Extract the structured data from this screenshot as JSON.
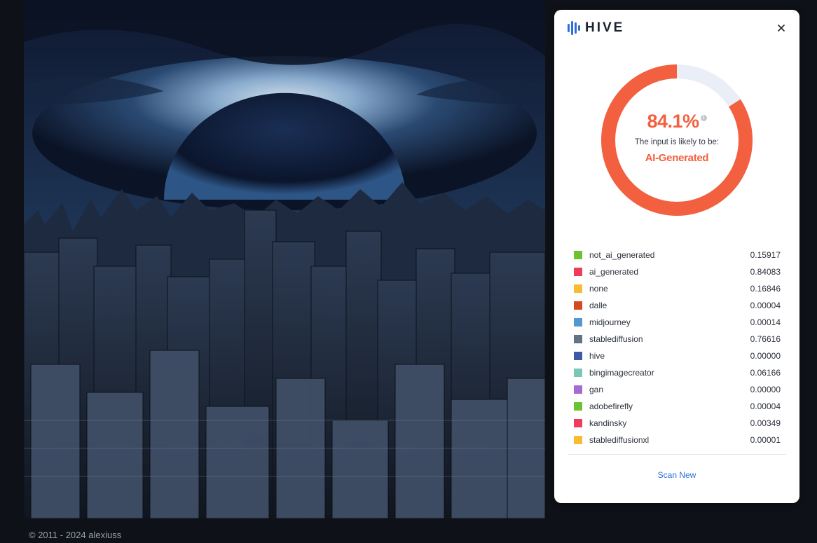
{
  "artwork": {
    "subject": "dark ruined city skyline under a black sphere eclipse with glowing blue clouds"
  },
  "footer": {
    "copyright": "© 2011 - 2024 alexiuss"
  },
  "panel": {
    "brand": "HIVE",
    "close_icon": "close-icon",
    "score": "84.1%",
    "score_fraction": 0.841,
    "likely_text": "The input is likely to be:",
    "verdict": "AI-Generated",
    "accent_color": "#f2603f",
    "track_color": "#eaeef7",
    "classes": [
      {
        "name": "not_ai_generated",
        "value": "0.15917",
        "color": "#6cc330"
      },
      {
        "name": "ai_generated",
        "value": "0.84083",
        "color": "#ef3c5b"
      },
      {
        "name": "none",
        "value": "0.16846",
        "color": "#f6bd32"
      },
      {
        "name": "dalle",
        "value": "0.00004",
        "color": "#d4491d"
      },
      {
        "name": "midjourney",
        "value": "0.00014",
        "color": "#5299d0"
      },
      {
        "name": "stablediffusion",
        "value": "0.76616",
        "color": "#637384"
      },
      {
        "name": "hive",
        "value": "0.00000",
        "color": "#3e5aa6"
      },
      {
        "name": "bingimagecreator",
        "value": "0.06166",
        "color": "#78c7b7"
      },
      {
        "name": "gan",
        "value": "0.00000",
        "color": "#a46cd1"
      },
      {
        "name": "adobefirefly",
        "value": "0.00004",
        "color": "#6cc330"
      },
      {
        "name": "kandinsky",
        "value": "0.00349",
        "color": "#ef3c5b"
      },
      {
        "name": "stablediffusionxl",
        "value": "0.00001",
        "color": "#f6bd32"
      }
    ],
    "scan_new": "Scan New"
  }
}
